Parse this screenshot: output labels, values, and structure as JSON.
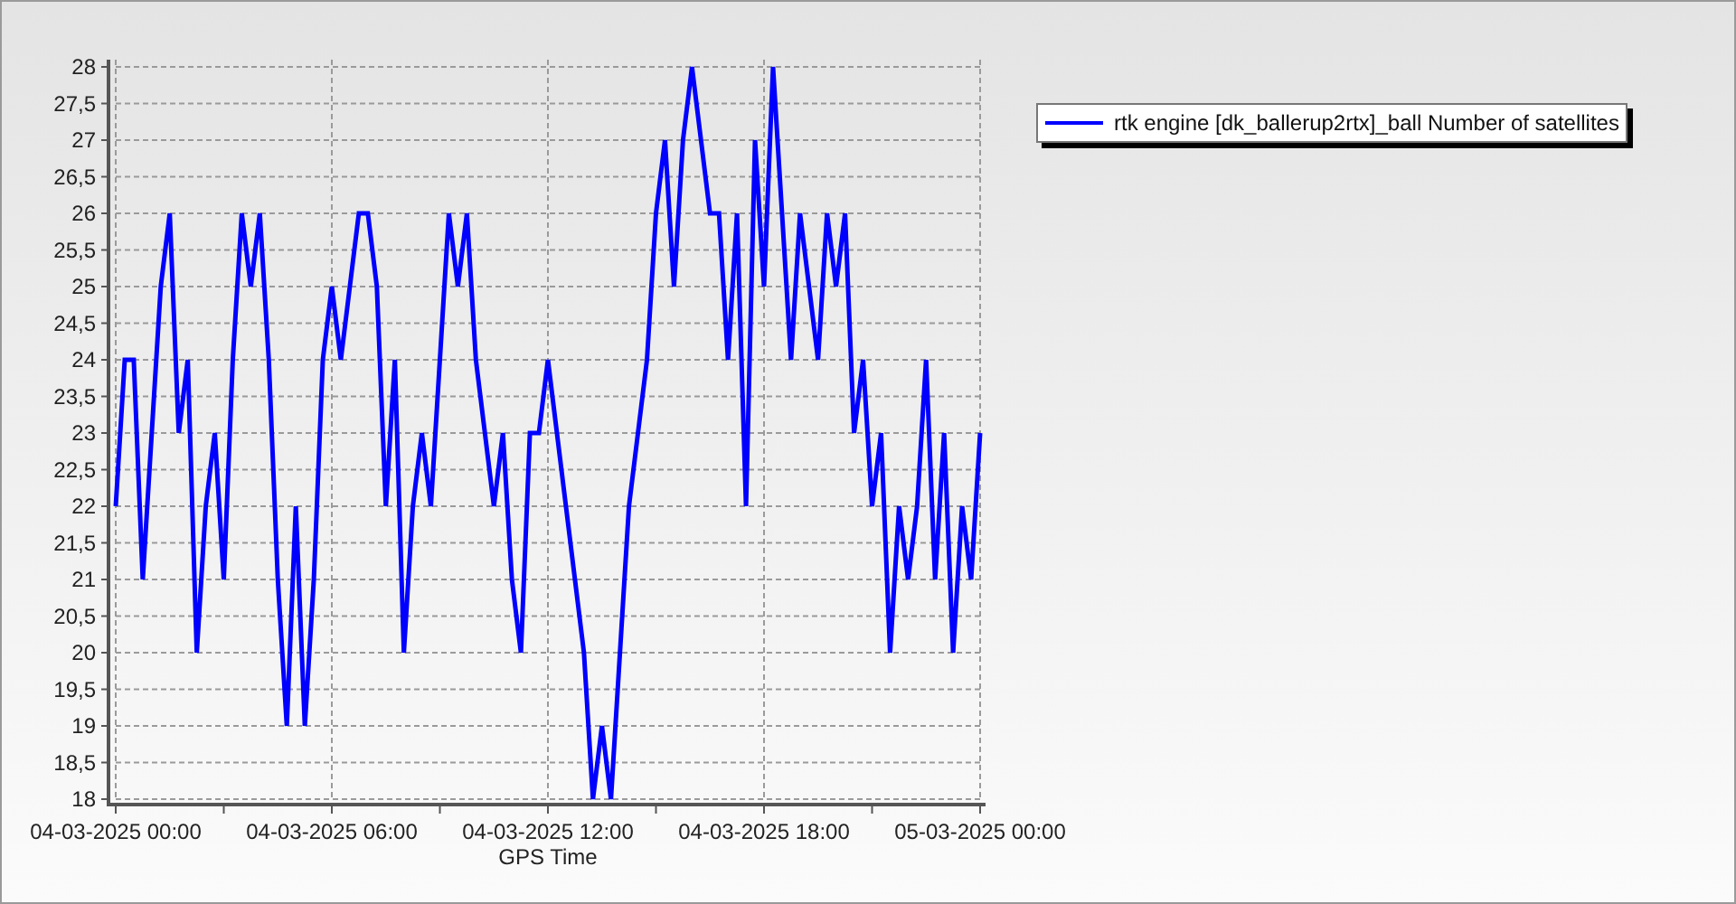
{
  "chart_data": {
    "type": "line",
    "grid": true,
    "xlabel": "GPS Time",
    "ylim": [
      18,
      28
    ],
    "yticks": [
      18,
      {
        "value": 18.5,
        "label": "18,5"
      },
      19,
      {
        "value": 19.5,
        "label": "19,5"
      },
      20,
      {
        "value": 20.5,
        "label": "20,5"
      },
      21,
      {
        "value": 21.5,
        "label": "21,5"
      },
      22,
      {
        "value": 22.5,
        "label": "22,5"
      },
      23,
      {
        "value": 23.5,
        "label": "23,5"
      },
      24,
      {
        "value": 24.5,
        "label": "24,5"
      },
      25,
      {
        "value": 25.5,
        "label": "25,5"
      },
      26,
      {
        "value": 26.5,
        "label": "26,5"
      },
      27,
      {
        "value": 27.5,
        "label": "27,5"
      },
      28
    ],
    "categories": [
      "04-03-2025 00:00",
      null,
      null,
      null,
      null,
      null,
      null,
      null,
      null,
      null,
      null,
      null,
      null,
      null,
      null,
      null,
      null,
      null,
      null,
      null,
      null,
      null,
      null,
      null,
      "04-03-2025 06:00",
      null,
      null,
      null,
      null,
      null,
      null,
      null,
      null,
      null,
      null,
      null,
      null,
      null,
      null,
      null,
      null,
      null,
      null,
      null,
      null,
      null,
      null,
      null,
      "04-03-2025 12:00",
      null,
      null,
      null,
      null,
      null,
      null,
      null,
      null,
      null,
      null,
      null,
      null,
      null,
      null,
      null,
      null,
      null,
      null,
      null,
      null,
      null,
      null,
      null,
      "04-03-2025 18:00",
      null,
      null,
      null,
      null,
      null,
      null,
      null,
      null,
      null,
      null,
      null,
      null,
      null,
      null,
      null,
      null,
      null,
      null,
      null,
      null,
      null,
      null,
      null,
      "05-03-2025 00:00"
    ],
    "series": [
      {
        "name": "rtk engine [dk_ballerup2rtx]_ball Number of satellites",
        "color": "#0000ff",
        "values": [
          22,
          24,
          24,
          21,
          23,
          25,
          26,
          23,
          24,
          20,
          22,
          23,
          21,
          24,
          26,
          25,
          26,
          24,
          21,
          19,
          22,
          19,
          21,
          24,
          25,
          24,
          25,
          26,
          26,
          25,
          22,
          24,
          20,
          22,
          23,
          22,
          24,
          26,
          25,
          26,
          24,
          23,
          22,
          23,
          21,
          20,
          23,
          23,
          24,
          23,
          22,
          21,
          20,
          18,
          19,
          18,
          20,
          22,
          23,
          24,
          26,
          27,
          25,
          27,
          28,
          27,
          26,
          26,
          24,
          26,
          22,
          27,
          25,
          28,
          26,
          24,
          26,
          25,
          24,
          26,
          25,
          26,
          23,
          24,
          22,
          23,
          20,
          22,
          21,
          22,
          24,
          21,
          23,
          20,
          22,
          21,
          23
        ]
      }
    ]
  }
}
